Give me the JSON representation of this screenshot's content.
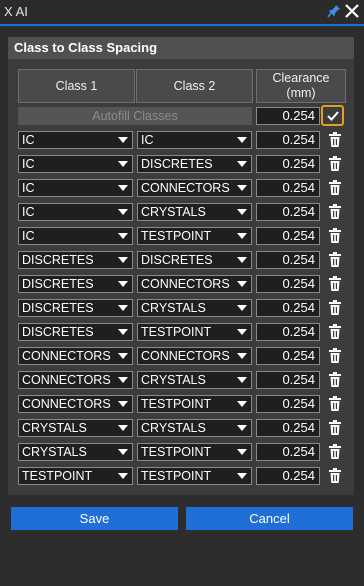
{
  "window": {
    "title": "X AI"
  },
  "panel": {
    "title": "Class to Class Spacing"
  },
  "headers": {
    "class1": "Class 1",
    "class2": "Class 2",
    "clearance": "Clearance (mm)"
  },
  "autofill": {
    "label": "Autofill Classes",
    "value": "0.254"
  },
  "rows": [
    {
      "c1": "IC",
      "c2": "IC",
      "clearance": "0.254"
    },
    {
      "c1": "IC",
      "c2": "DISCRETES",
      "clearance": "0.254"
    },
    {
      "c1": "IC",
      "c2": "CONNECTORS",
      "clearance": "0.254"
    },
    {
      "c1": "IC",
      "c2": "CRYSTALS",
      "clearance": "0.254"
    },
    {
      "c1": "IC",
      "c2": "TESTPOINT",
      "clearance": "0.254"
    },
    {
      "c1": "DISCRETES",
      "c2": "DISCRETES",
      "clearance": "0.254"
    },
    {
      "c1": "DISCRETES",
      "c2": "CONNECTORS",
      "clearance": "0.254"
    },
    {
      "c1": "DISCRETES",
      "c2": "CRYSTALS",
      "clearance": "0.254"
    },
    {
      "c1": "DISCRETES",
      "c2": "TESTPOINT",
      "clearance": "0.254"
    },
    {
      "c1": "CONNECTORS",
      "c2": "CONNECTORS",
      "clearance": "0.254"
    },
    {
      "c1": "CONNECTORS",
      "c2": "CRYSTALS",
      "clearance": "0.254"
    },
    {
      "c1": "CONNECTORS",
      "c2": "TESTPOINT",
      "clearance": "0.254"
    },
    {
      "c1": "CRYSTALS",
      "c2": "CRYSTALS",
      "clearance": "0.254"
    },
    {
      "c1": "CRYSTALS",
      "c2": "TESTPOINT",
      "clearance": "0.254"
    },
    {
      "c1": "TESTPOINT",
      "c2": "TESTPOINT",
      "clearance": "0.254"
    }
  ],
  "buttons": {
    "save": "Save",
    "cancel": "Cancel"
  },
  "colors": {
    "accent": "#1f6fd6",
    "confirm_border": "#e0a020"
  }
}
